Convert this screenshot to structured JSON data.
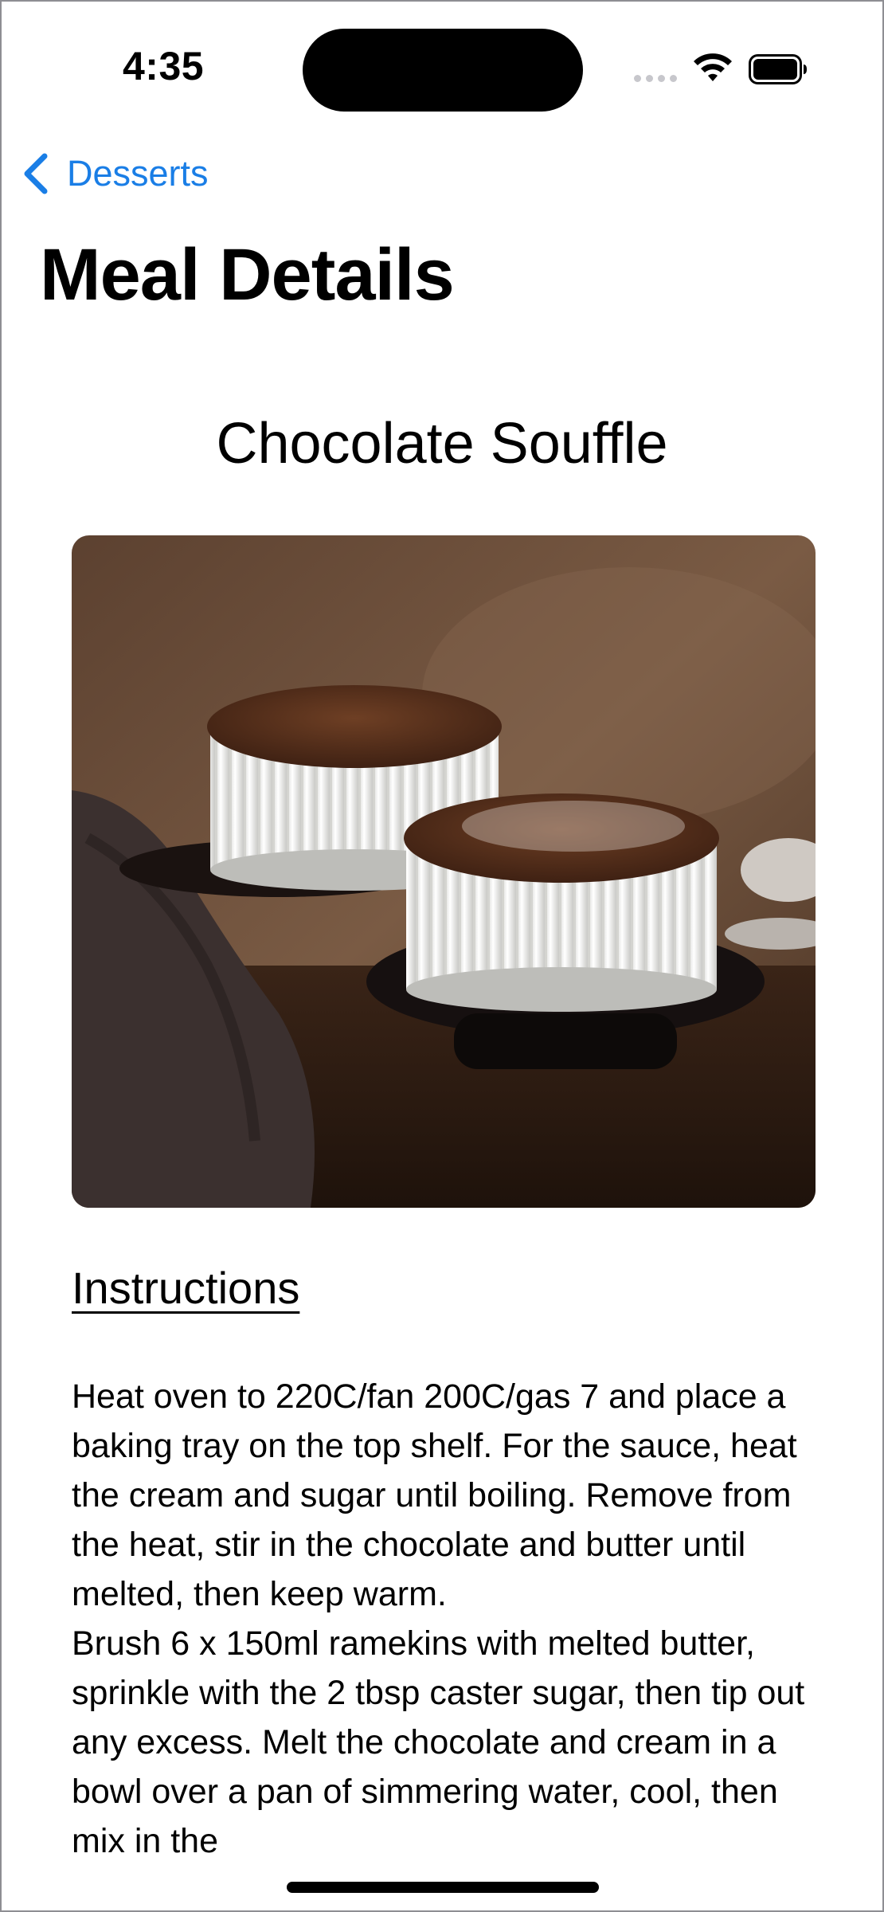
{
  "status_bar": {
    "time": "4:35"
  },
  "nav": {
    "back_label": "Desserts",
    "title": "Meal Details"
  },
  "meal": {
    "name": "Chocolate Souffle",
    "instructions_heading": "Instructions",
    "instructions": "Heat oven to 220C/fan 200C/gas 7 and place a baking tray on the top shelf. For the sauce, heat the cream and sugar until boiling. Remove from the heat, stir in the chocolate and butter until melted, then keep warm.\nBrush 6 x 150ml ramekins with melted butter, sprinkle with the 2 tbsp caster sugar, then tip out any excess. Melt the chocolate and cream in a bowl over a pan of simmering water, cool, then mix in the"
  },
  "colors": {
    "accent": "#1a7ee6",
    "background": "#ffffff",
    "text": "#000000"
  },
  "icons": {
    "back": "chevron-left-icon",
    "wifi": "wifi-icon",
    "battery": "battery-icon"
  }
}
